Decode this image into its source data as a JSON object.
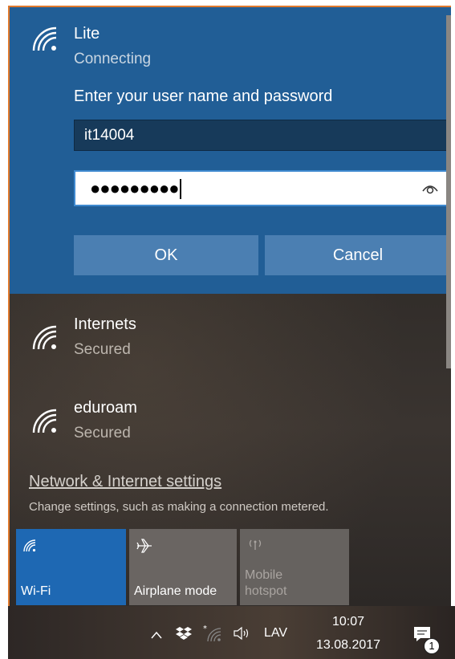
{
  "connecting_network": {
    "name": "Lite",
    "status": "Connecting",
    "prompt": "Enter your user name and password",
    "username_value": "it14004",
    "password_masked": "●●●●●●●●●",
    "ok_label": "OK",
    "cancel_label": "Cancel"
  },
  "networks": [
    {
      "name": "Internets",
      "status": "Secured"
    },
    {
      "name": "eduroam",
      "status": "Secured"
    }
  ],
  "settings": {
    "link_label": "Network & Internet settings",
    "description": "Change settings, such as making a connection metered."
  },
  "quick_actions": {
    "wifi_label": "Wi-Fi",
    "airplane_label": "Airplane mode",
    "hotspot_label_line1": "Mobile",
    "hotspot_label_line2": "hotspot"
  },
  "taskbar": {
    "language": "LAV",
    "time": "10:07",
    "date": "13.08.2017",
    "notification_count": "1"
  },
  "colors": {
    "accent": "#215e96",
    "button": "#4b7fb2",
    "wifi_tile": "#1e68b3"
  }
}
